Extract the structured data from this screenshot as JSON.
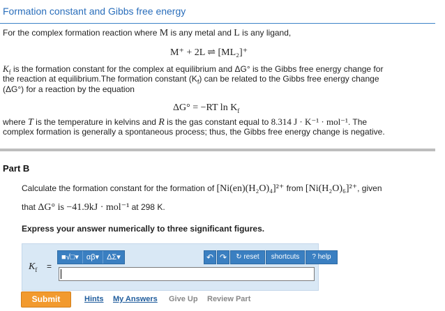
{
  "intro": {
    "title": "Formation constant and Gibbs free energy",
    "line1a": "For the complex formation reaction where ",
    "line1b": "M",
    "line1c": " is any metal and ",
    "line1d": "L",
    "line1e": " is any ligand,",
    "eq1": "M⁺ + 2L ⇌ [ML₂]⁺",
    "p2": "is the formation constant for the complex at equilibrium and ΔG° is the Gibbs free energy change for",
    "kf_symbol": "K",
    "kf_sub": "f",
    "p3": "the reaction at equilibrium.The formation constant (K",
    "p3b": ") can be related to the Gibbs free energy change",
    "p4": "(ΔG°) for a reaction by the equation",
    "eq2": "ΔG° = −RT ln K",
    "eq2_sub": "f",
    "p5a": "where ",
    "p5b": "T",
    "p5c": " is the temperature in kelvins and ",
    "p5d": "R",
    "p5e": " is the gas constant equal to ",
    "p5f": "8.314 J · K⁻¹ · mol⁻¹",
    "p5g": ". The",
    "p6": "complex formation is generally a spontaneous process; thus, the Gibbs free energy change is negative."
  },
  "partb": {
    "title": "Part B",
    "q1a": "Calculate the formation constant for the formation of ",
    "q1b": "[Ni(en)(H₂O)₄]²⁺",
    "q1c": " from ",
    "q1d": "[Ni(H₂O)₆]²⁺",
    "q1e": ", given",
    "q2a": "that ",
    "q2b": "ΔG° is −41.9kJ · mol⁻¹",
    "q2c": " at 298 K.",
    "instruction": "Express your answer numerically to three significant figures."
  },
  "answer": {
    "label": "K",
    "label_sub": "f",
    "equals": "=",
    "tools": [
      "■√□▾",
      "αβ▾",
      "ΔΣ▾"
    ],
    "undo_icon": "↶",
    "redo_icon": "↷",
    "reset_label": "↻ reset",
    "shortcuts_label": "shortcuts",
    "help_label": "? help",
    "value": ""
  },
  "actions": {
    "submit": "Submit",
    "hints": "Hints",
    "my_answers": "My Answers",
    "give_up": "Give Up",
    "review_part": "Review Part"
  }
}
